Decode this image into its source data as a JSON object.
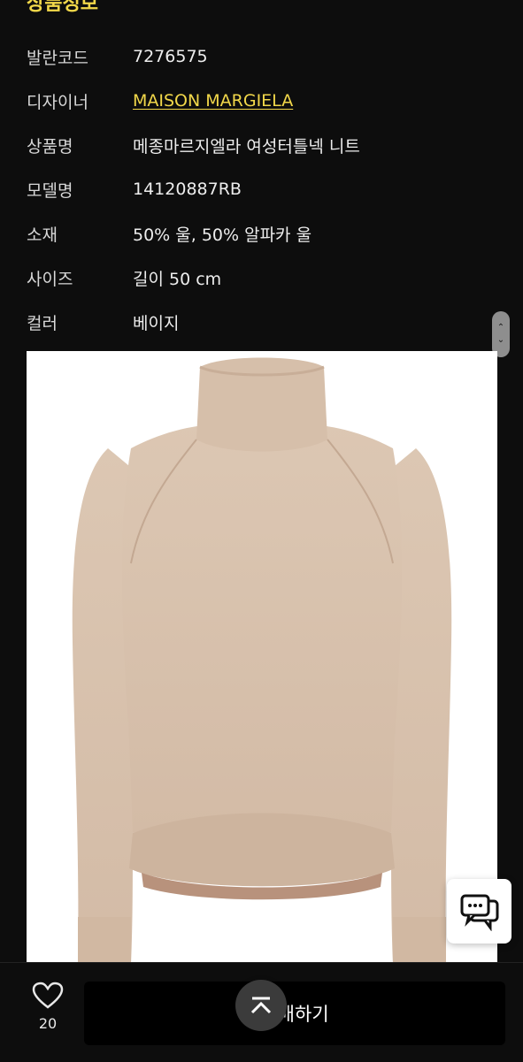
{
  "section": {
    "title": "상품정보"
  },
  "info": {
    "rows": [
      {
        "label": "발란코드",
        "value": "7276575"
      },
      {
        "label": "디자이너",
        "value": "MAISON MARGIELA"
      },
      {
        "label": "상품명",
        "value": "메종마르지엘라 여성터틀넥 니트"
      },
      {
        "label": "모델명",
        "value": "14120887RB"
      },
      {
        "label": "소재",
        "value": "50% 울, 50% 알파카 울"
      },
      {
        "label": "사이즈",
        "value": "길이 50 cm"
      },
      {
        "label": "컬러",
        "value": "베이지"
      }
    ]
  },
  "image": {
    "description_icon": "beige-turtleneck-sweater-image"
  },
  "bottom_bar": {
    "wish_count": "20",
    "action_label": "구매하기"
  },
  "colors": {
    "background": "#0d0d0d",
    "accent": "#f2d84a",
    "sweater": "#d9c3af"
  }
}
